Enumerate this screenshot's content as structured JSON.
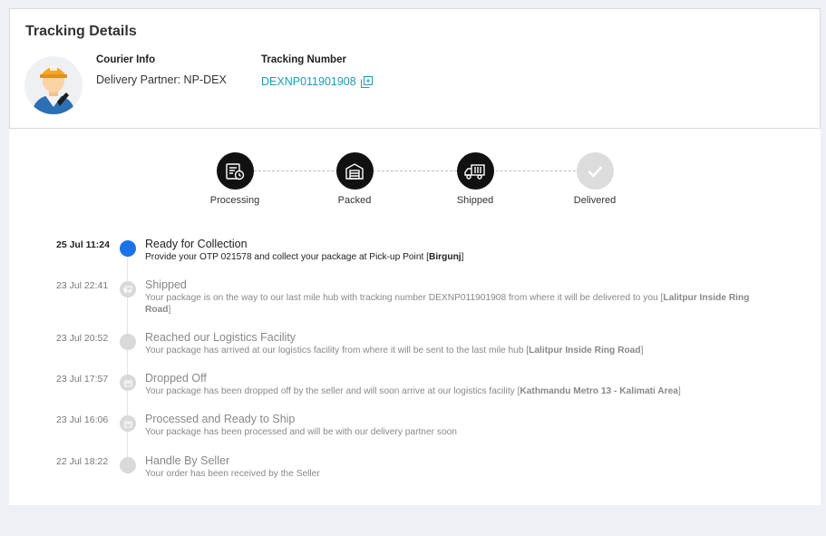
{
  "header": {
    "title": "Tracking Details",
    "courier_label": "Courier Info",
    "courier_value": "Delivery Partner: NP-DEX",
    "tracking_label": "Tracking Number",
    "tracking_value": "DEXNP011901908"
  },
  "steps": [
    {
      "label": "Processing",
      "icon": "invoice-clock-icon",
      "status": "complete"
    },
    {
      "label": "Packed",
      "icon": "warehouse-icon",
      "status": "complete"
    },
    {
      "label": "Shipped",
      "icon": "truck-icon",
      "status": "complete"
    },
    {
      "label": "Delivered",
      "icon": "check-icon",
      "status": "pending"
    }
  ],
  "timeline": [
    {
      "date": "25 Jul 11:24",
      "title": "Ready for Collection",
      "desc_pre": "Provide your OTP 021578 and collect your package at Pick-up Point [",
      "desc_bold": "Birgunj",
      "desc_post": "]",
      "active": true
    },
    {
      "date": "23 Jul 22:41",
      "title": "Shipped",
      "desc_pre": "Your package is on the way to our last mile hub with tracking number DEXNP011901908 from where it will be delivered to you [",
      "desc_bold": "Lalitpur Inside Ring Road",
      "desc_post": "]",
      "active": false
    },
    {
      "date": "23 Jul 20:52",
      "title": "Reached our Logistics Facility",
      "desc_pre": "Your package has arrived at our logistics facility from where it will be sent to the last mile hub [",
      "desc_bold": "Lalitpur Inside Ring Road",
      "desc_post": "]",
      "active": false
    },
    {
      "date": "23 Jul 17:57",
      "title": "Dropped Off",
      "desc_pre": "Your package has been dropped off by the seller and will soon arrive at our logistics facility [",
      "desc_bold": "Kathmandu Metro 13 - Kalimati Area",
      "desc_post": "]",
      "active": false
    },
    {
      "date": "23 Jul 16:06",
      "title": "Processed and Ready to Ship",
      "desc_pre": "Your package has been processed and will be with our delivery partner soon",
      "desc_bold": "",
      "desc_post": "",
      "active": false
    },
    {
      "date": "22 Jul 18:22",
      "title": "Handle By Seller",
      "desc_pre": "Your order has been received by the Seller",
      "desc_bold": "",
      "desc_post": "",
      "active": false
    }
  ],
  "colors": {
    "accent_link": "#1a9cb7",
    "active_dot": "#1a73e8"
  }
}
